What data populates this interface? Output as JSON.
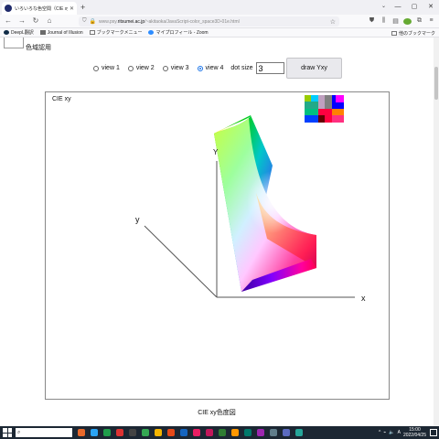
{
  "browser": {
    "tab_title": "いろいろな色空間（CIE xy, CIELuv",
    "new_tab": "+",
    "url_prefix": "www.psy.",
    "url_host": "ritsumei.ac.jp",
    "url_path": "/~akitaoka/JavaScript-color_space3D-01e.html",
    "bookmarks": [
      {
        "label": "DeepL翻訳",
        "color": "#0f2b46"
      },
      {
        "label": "Journal of Illusion",
        "color": "#6b6b6b"
      },
      {
        "label": "ブックマークメニュー",
        "color": "#c89b3c"
      },
      {
        "label": "マイプロフィール - Zoom",
        "color": "#2d8cff"
      }
    ],
    "other_bookmarks": "他のブックマーク"
  },
  "page": {
    "gamut_label": "色域認用",
    "radios": [
      {
        "label": "view 1",
        "checked": false
      },
      {
        "label": "view 2",
        "checked": false
      },
      {
        "label": "view 3",
        "checked": false
      },
      {
        "label": "view 4",
        "checked": true
      }
    ],
    "dot_size_label": "dot size",
    "dot_size_value": "3",
    "draw_button": "draw Yxy",
    "canvas_title": "CIE xy",
    "axis_x": "x",
    "axis_y": "y",
    "axis_Y": "Y",
    "caption": "CIE xy色度図"
  },
  "taskbar": {
    "time": "15:00",
    "date": "2022/04/25",
    "apps": [
      "#e8692b",
      "#2aa4f4",
      "#1f9e4b",
      "#d33",
      "#444",
      "#35a853",
      "#f4b400",
      "#e64a19",
      "#1565c0",
      "#e91e63",
      "#c2185b",
      "#2e7d32",
      "#ff9800",
      "#00796b",
      "#9c27b0",
      "#607d8b",
      "#5b6bc0",
      "#26a69a"
    ]
  },
  "colors": {
    "accent": "#1a73e8",
    "taskbar": "#1c2733"
  }
}
